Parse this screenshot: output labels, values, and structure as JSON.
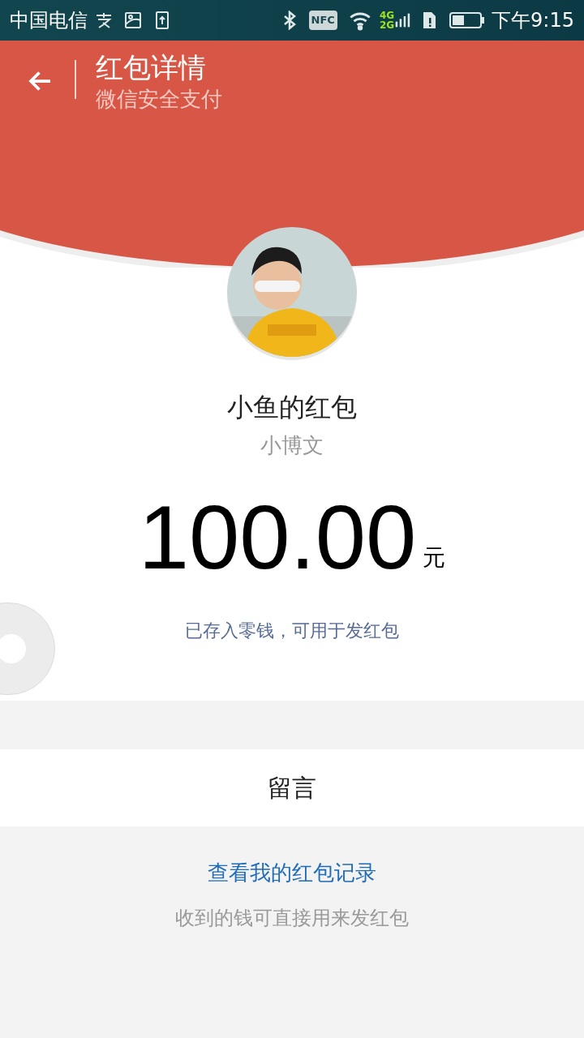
{
  "status_bar": {
    "carrier": "中国电信",
    "nfc": "NFC",
    "network_top": "4G",
    "network_bottom": "2G",
    "time": "下午9:15"
  },
  "header": {
    "title": "红包详情",
    "subtitle": "微信安全支付"
  },
  "packet": {
    "title": "小鱼的红包",
    "sender": "小博文",
    "amount": "100.00",
    "unit": "元",
    "note": "已存入零钱，可用于发红包"
  },
  "message_row": {
    "label": "留言"
  },
  "footer": {
    "link": "查看我的红包记录",
    "hint": "收到的钱可直接用来发红包"
  }
}
